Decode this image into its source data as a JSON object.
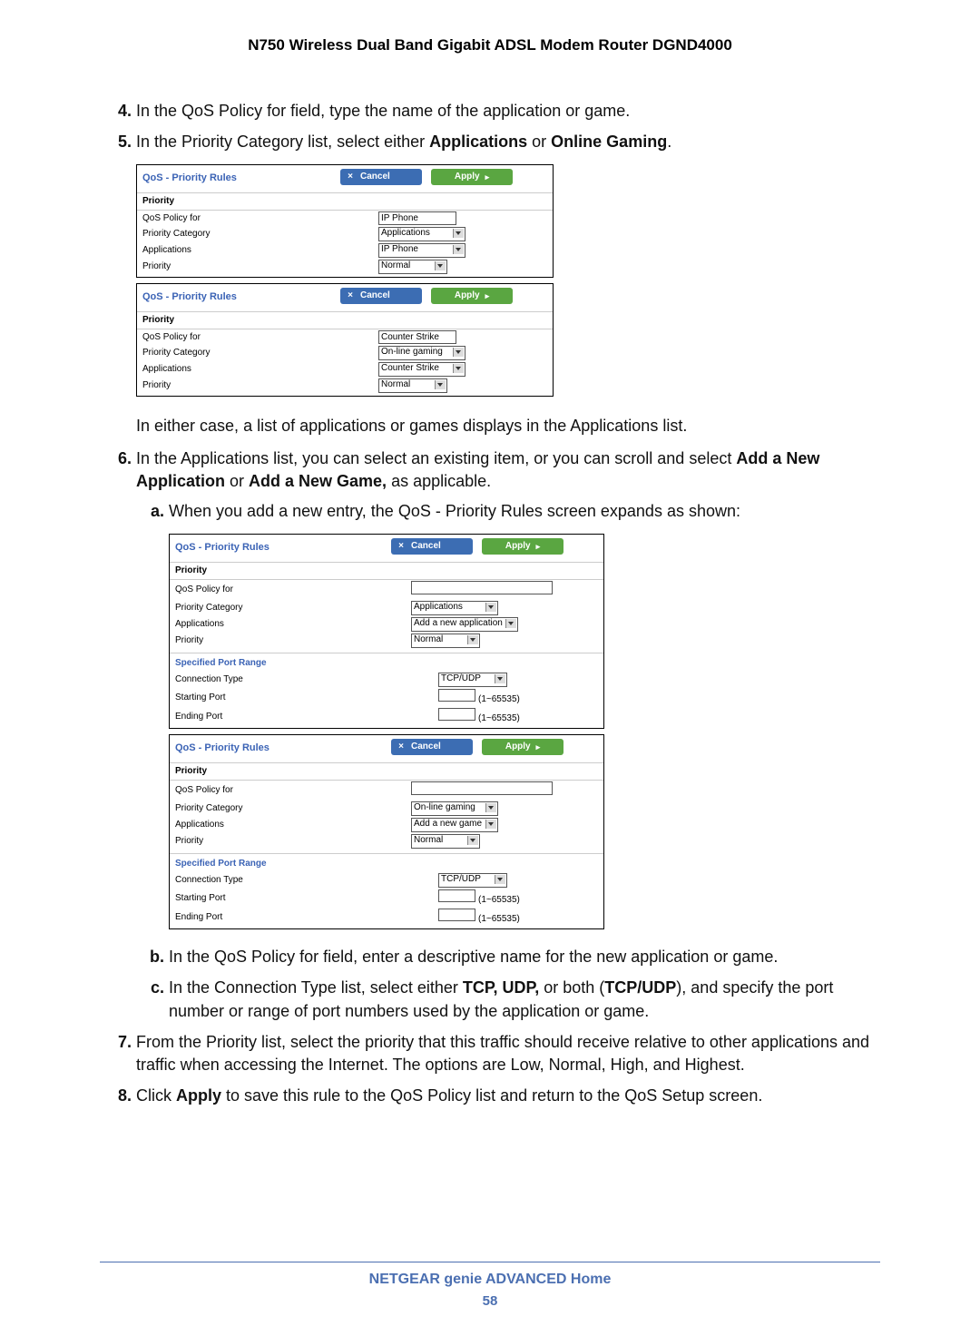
{
  "doc_title": "N750 Wireless Dual Band Gigabit ADSL Modem Router DGND4000",
  "steps": {
    "s4": "In the QoS Policy for field, type the name of the application or game.",
    "s5_intro": "In the Priority Category list, select either ",
    "s5_b1": "Applications",
    "s5_or": " or ",
    "s5_b2": "Online Gaming",
    "s5_end": ".",
    "s5_after": "In either case, a list of applications or games displays in the Applications list.",
    "s6_intro": "In the Applications list, you can select an existing item, or you can scroll and select ",
    "s6_b1": "Add a New Application",
    "s6_or": " or ",
    "s6_b2": "Add a New Game,",
    "s6_end": " as applicable.",
    "s6a": "When you add a new entry, the QoS - Priority Rules screen expands as shown:",
    "s6b": "In the QoS Policy for field, enter a descriptive name for the new application or game.",
    "s6c_intro": "In the Connection Type list, select either ",
    "s6c_b1": "TCP, UDP,",
    "s6c_mid": " or both (",
    "s6c_b2": "TCP/UDP",
    "s6c_end": "), and specify the port number or range of port numbers used by the application or game.",
    "s7": "From the Priority list, select the priority that this traffic should receive relative to other applications and traffic when accessing the Internet. The options are Low, Normal, High, and Highest.",
    "s8_pre": "Click ",
    "s8_b": "Apply",
    "s8_post": " to save this rule to the QoS Policy list and return to the QoS Setup screen."
  },
  "panel_common": {
    "title": "QoS - Priority Rules",
    "cancel": "Cancel",
    "apply": "Apply",
    "priority_section": "Priority",
    "specified_port_range": "Specified Port Range",
    "labels": {
      "qos_policy_for": "QoS Policy for",
      "priority_category": "Priority Category",
      "applications": "Applications",
      "priority": "Priority",
      "connection_type": "Connection Type",
      "starting_port": "Starting Port",
      "ending_port": "Ending Port"
    },
    "port_hint": "(1~65535)"
  },
  "panel1": {
    "qos_policy_for": "IP Phone",
    "priority_category": "Applications",
    "applications": "IP Phone",
    "priority": "Normal"
  },
  "panel2": {
    "qos_policy_for": "Counter Strike",
    "priority_category": "On-line gaming",
    "applications": "Counter Strike",
    "priority": "Normal"
  },
  "panel3": {
    "qos_policy_for": "",
    "priority_category": "Applications",
    "applications": "Add a new application",
    "priority": "Normal",
    "connection_type": "TCP/UDP"
  },
  "panel4": {
    "qos_policy_for": "",
    "priority_category": "On-line gaming",
    "applications": "Add a new game",
    "priority": "Normal",
    "connection_type": "TCP/UDP"
  },
  "footer": {
    "label": "NETGEAR genie ADVANCED Home",
    "page": "58"
  }
}
